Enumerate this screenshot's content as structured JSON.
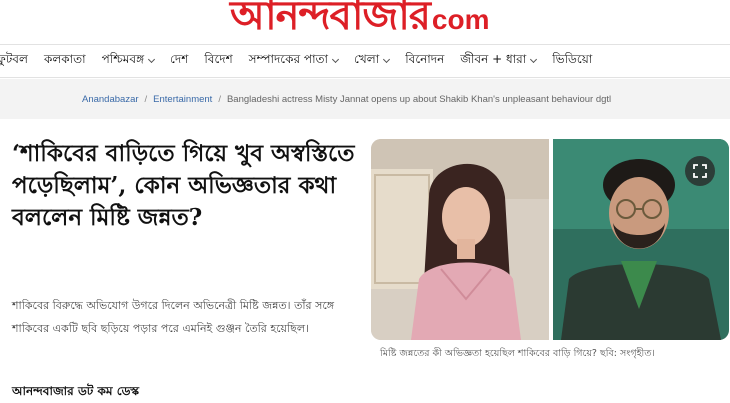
{
  "site": {
    "logo_bengali": "আনন্দবাজার",
    "logo_tld": "com",
    "brand_color": "#dd1f26"
  },
  "nav": {
    "items": [
      {
        "label": "ফুটবল",
        "has_dropdown": false
      },
      {
        "label": "কলকাতা",
        "has_dropdown": false
      },
      {
        "label": "পশ্চিমবঙ্গ",
        "has_dropdown": true
      },
      {
        "label": "দেশ",
        "has_dropdown": false
      },
      {
        "label": "বিদেশ",
        "has_dropdown": false
      },
      {
        "label": "সম্পাদকের পাতা",
        "has_dropdown": true
      },
      {
        "label": "খেলা",
        "has_dropdown": true
      },
      {
        "label": "বিনোদন",
        "has_dropdown": false
      },
      {
        "label": "জীবন + ধারা",
        "has_dropdown": true
      },
      {
        "label": "ভিডিয়ো",
        "has_dropdown": false
      }
    ]
  },
  "breadcrumb": {
    "items": [
      "Anandabazar",
      "Entertainment"
    ],
    "separator": "/",
    "current": "Bangladeshi actress Misty Jannat opens up about Shakib Khan's unpleasant behaviour dgtl"
  },
  "article": {
    "headline": "‘শাকিবের বাড়িতে গিয়ে খুব অস্বস্তিতে পড়েছিলাম’, কোন অভিজ্ঞতার কথা বললেন মিষ্টি জন্নত?",
    "summary": "শাকিবের বিরুদ্ধে অভিযোগ উগরে দিলেন অভিনেত্রী মিষ্টি জন্নত। তাঁর সঙ্গে শাকিবের একটি ছবি ছড়িয়ে পড়ার পরে এমনিই গুঞ্জন তৈরি হয়েছিল।",
    "byline": "আনন্দবাজার ডট কম ডেস্ক",
    "image_caption": "মিষ্টি জন্নতের কী অভিজ্ঞতা হয়েছিল শাকিবের বাড়ি গিয়ে? ছবি: সংগৃহীত।",
    "expand_icon": "expand-icon"
  }
}
